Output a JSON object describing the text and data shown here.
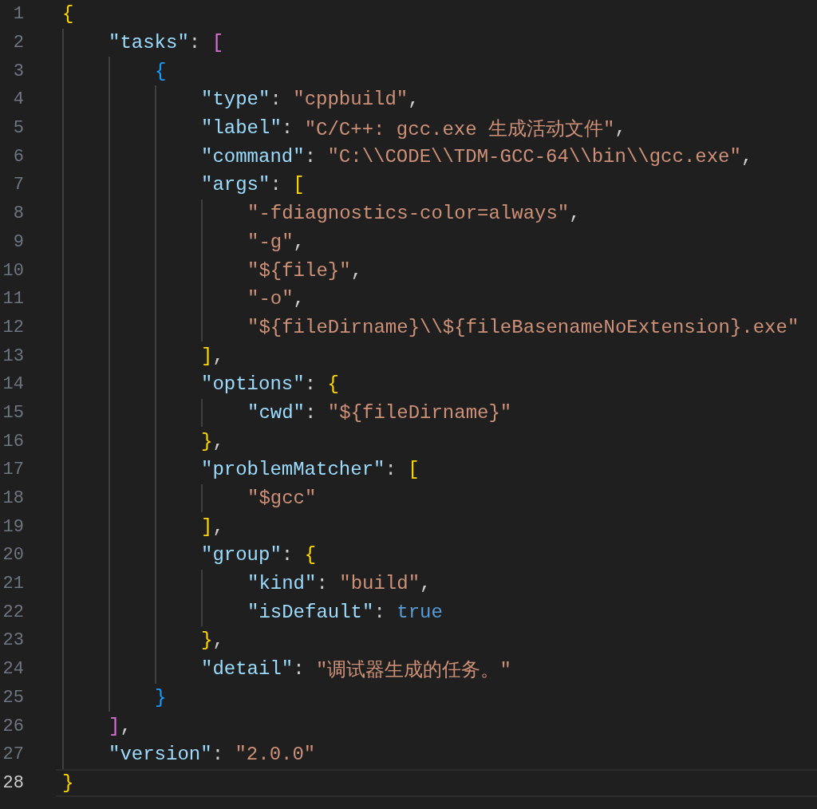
{
  "editor": {
    "lines": [
      {
        "number": "1",
        "current": false,
        "tokens": [
          {
            "kind": "bracket",
            "text": "{"
          }
        ]
      },
      {
        "number": "2",
        "current": false,
        "tokens": [
          {
            "kind": "key",
            "text": "\"tasks\""
          },
          {
            "kind": "punct",
            "text": ": "
          },
          {
            "kind": "bracket",
            "text": "["
          }
        ]
      },
      {
        "number": "3",
        "current": false,
        "tokens": [
          {
            "kind": "bracket",
            "text": "{"
          }
        ]
      },
      {
        "number": "4",
        "current": false,
        "tokens": [
          {
            "kind": "key",
            "text": "\"type\""
          },
          {
            "kind": "punct",
            "text": ": "
          },
          {
            "kind": "string",
            "text": "\"cppbuild\""
          },
          {
            "kind": "punct",
            "text": ","
          }
        ]
      },
      {
        "number": "5",
        "current": false,
        "tokens": [
          {
            "kind": "key",
            "text": "\"label\""
          },
          {
            "kind": "punct",
            "text": ": "
          },
          {
            "kind": "string",
            "text": "\"C/C++: gcc.exe 生成活动文件\""
          },
          {
            "kind": "punct",
            "text": ","
          }
        ]
      },
      {
        "number": "6",
        "current": false,
        "tokens": [
          {
            "kind": "key",
            "text": "\"command\""
          },
          {
            "kind": "punct",
            "text": ": "
          },
          {
            "kind": "string",
            "text": "\"C:\\\\CODE\\\\TDM-GCC-64\\\\bin\\\\gcc.exe\""
          },
          {
            "kind": "punct",
            "text": ","
          }
        ]
      },
      {
        "number": "7",
        "current": false,
        "tokens": [
          {
            "kind": "key",
            "text": "\"args\""
          },
          {
            "kind": "punct",
            "text": ": "
          },
          {
            "kind": "bracket",
            "text": "["
          }
        ]
      },
      {
        "number": "8",
        "current": false,
        "tokens": [
          {
            "kind": "string",
            "text": "\"-fdiagnostics-color=always\""
          },
          {
            "kind": "punct",
            "text": ","
          }
        ]
      },
      {
        "number": "9",
        "current": false,
        "tokens": [
          {
            "kind": "string",
            "text": "\"-g\""
          },
          {
            "kind": "punct",
            "text": ","
          }
        ]
      },
      {
        "number": "10",
        "current": false,
        "tokens": [
          {
            "kind": "string",
            "text": "\"${file}\""
          },
          {
            "kind": "punct",
            "text": ","
          }
        ]
      },
      {
        "number": "11",
        "current": false,
        "tokens": [
          {
            "kind": "string",
            "text": "\"-o\""
          },
          {
            "kind": "punct",
            "text": ","
          }
        ]
      },
      {
        "number": "12",
        "current": false,
        "tokens": [
          {
            "kind": "string",
            "text": "\"${fileDirname}\\\\${fileBasenameNoExtension}.exe\""
          }
        ]
      },
      {
        "number": "13",
        "current": false,
        "tokens": [
          {
            "kind": "bracket",
            "text": "]"
          },
          {
            "kind": "punct",
            "text": ","
          }
        ]
      },
      {
        "number": "14",
        "current": false,
        "tokens": [
          {
            "kind": "key",
            "text": "\"options\""
          },
          {
            "kind": "punct",
            "text": ": "
          },
          {
            "kind": "bracket",
            "text": "{"
          }
        ]
      },
      {
        "number": "15",
        "current": false,
        "tokens": [
          {
            "kind": "key",
            "text": "\"cwd\""
          },
          {
            "kind": "punct",
            "text": ": "
          },
          {
            "kind": "string",
            "text": "\"${fileDirname}\""
          }
        ]
      },
      {
        "number": "16",
        "current": false,
        "tokens": [
          {
            "kind": "bracket",
            "text": "}"
          },
          {
            "kind": "punct",
            "text": ","
          }
        ]
      },
      {
        "number": "17",
        "current": false,
        "tokens": [
          {
            "kind": "key",
            "text": "\"problemMatcher\""
          },
          {
            "kind": "punct",
            "text": ": "
          },
          {
            "kind": "bracket",
            "text": "["
          }
        ]
      },
      {
        "number": "18",
        "current": false,
        "tokens": [
          {
            "kind": "string",
            "text": "\"$gcc\""
          }
        ]
      },
      {
        "number": "19",
        "current": false,
        "tokens": [
          {
            "kind": "bracket",
            "text": "]"
          },
          {
            "kind": "punct",
            "text": ","
          }
        ]
      },
      {
        "number": "20",
        "current": false,
        "tokens": [
          {
            "kind": "key",
            "text": "\"group\""
          },
          {
            "kind": "punct",
            "text": ": "
          },
          {
            "kind": "bracket",
            "text": "{"
          }
        ]
      },
      {
        "number": "21",
        "current": false,
        "tokens": [
          {
            "kind": "key",
            "text": "\"kind\""
          },
          {
            "kind": "punct",
            "text": ": "
          },
          {
            "kind": "string",
            "text": "\"build\""
          },
          {
            "kind": "punct",
            "text": ","
          }
        ]
      },
      {
        "number": "22",
        "current": false,
        "tokens": [
          {
            "kind": "key",
            "text": "\"isDefault\""
          },
          {
            "kind": "punct",
            "text": ": "
          },
          {
            "kind": "keyword",
            "text": "true"
          }
        ]
      },
      {
        "number": "23",
        "current": false,
        "tokens": [
          {
            "kind": "bracket",
            "text": "}"
          },
          {
            "kind": "punct",
            "text": ","
          }
        ]
      },
      {
        "number": "24",
        "current": false,
        "tokens": [
          {
            "kind": "key",
            "text": "\"detail\""
          },
          {
            "kind": "punct",
            "text": ": "
          },
          {
            "kind": "string",
            "text": "\"调试器生成的任务。\""
          }
        ]
      },
      {
        "number": "25",
        "current": false,
        "tokens": [
          {
            "kind": "bracket",
            "text": "}"
          }
        ]
      },
      {
        "number": "26",
        "current": false,
        "tokens": [
          {
            "kind": "bracket",
            "text": "]"
          },
          {
            "kind": "punct",
            "text": ","
          }
        ]
      },
      {
        "number": "27",
        "current": false,
        "tokens": [
          {
            "kind": "key",
            "text": "\"version\""
          },
          {
            "kind": "punct",
            "text": ": "
          },
          {
            "kind": "string",
            "text": "\"2.0.0\""
          }
        ]
      },
      {
        "number": "28",
        "current": true,
        "tokens": [
          {
            "kind": "bracket",
            "text": "}"
          }
        ]
      }
    ]
  }
}
